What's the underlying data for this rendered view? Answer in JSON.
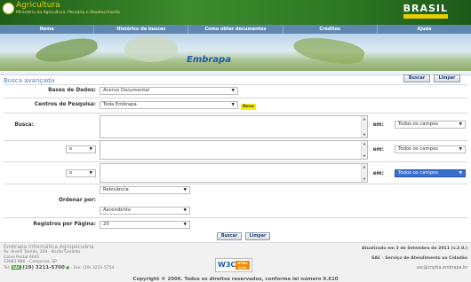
{
  "header": {
    "ministry_title": "Agricultura",
    "ministry_subtitle": "Ministério da Agricultura, Pecuária e Abastecimento",
    "brasil": "BRASIL"
  },
  "nav": {
    "items": [
      "Home",
      "Histórico de buscas",
      "Como obter documentos",
      "Créditos",
      "Ajuda"
    ]
  },
  "banner": {
    "brand": "Embrapa"
  },
  "page": {
    "title": "Busca avançada"
  },
  "top_buttons": {
    "search": "Buscar",
    "clear": "Limpar"
  },
  "form": {
    "bases_label": "Bases de Dados:",
    "bases_value": "Acervo Documental",
    "centros_label": "Centros de Pesquisa:",
    "centros_value": "Toda Embrapa",
    "novo_badge": "Novo",
    "busca_label": "Busca:",
    "em_label": "em:",
    "field_row1": "Todos os campos",
    "op_row2": "e",
    "field_row2": "Todos os campos",
    "op_row3": "e",
    "field_row3": "Todos os campos",
    "ordenar_label": "Ordenar por:",
    "order_by": "Relevância",
    "order_dir": "Ascendente",
    "registros_label": "Registros por Página:",
    "registros_value": "20"
  },
  "bottom_buttons": {
    "search": "Buscar",
    "clear": "Limpar"
  },
  "footer": {
    "org": "Embrapa Informática Agropecuária",
    "address1": "Av. André Tosello, 209 - Barão Geraldo",
    "address2": "Caixa Postal 6041",
    "address3": "13083-886 - Campinas, SP",
    "phone_prefix": "Tel:",
    "phone_tag": "SAC",
    "phone": "(19) 3211-5700",
    "fax": "- Fax: (19) 3211-5754",
    "w3c": "W3C",
    "w3c_html": "HTML 4.01",
    "updated": "Atualizado em 3 de Setembro de 2011 (v.2.0.)",
    "sac": "SAC - Serviço de Atendimento ao Cidadão",
    "email": "sac@cnptia.embrapa.br",
    "copyright": "Copyright © 2006. Todos os direitos reservados, conforme lei número 9.610"
  }
}
